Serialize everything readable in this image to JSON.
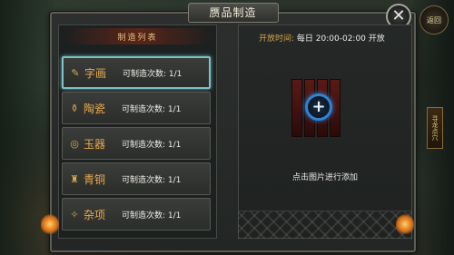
{
  "side": {
    "back_label": "返回",
    "banner_label": "寻龙点穴"
  },
  "panel": {
    "title": "赝品制造",
    "close_glyph": "✕"
  },
  "list": {
    "header": "制造列表",
    "items": [
      {
        "icon": "scroll-icon",
        "glyph": "✎",
        "name": "字画",
        "count": "可制造次数: 1/1",
        "selected": true
      },
      {
        "icon": "pottery-icon",
        "glyph": "⚱",
        "name": "陶瓷",
        "count": "可制造次数: 1/1",
        "selected": false
      },
      {
        "icon": "jade-icon",
        "glyph": "◎",
        "name": "玉器",
        "count": "可制造次数: 1/1",
        "selected": false
      },
      {
        "icon": "bronze-icon",
        "glyph": "♜",
        "name": "青铜",
        "count": "可制造次数: 1/1",
        "selected": false
      },
      {
        "icon": "misc-icon",
        "glyph": "✧",
        "name": "杂项",
        "count": "可制造次数: 1/1",
        "selected": false
      }
    ]
  },
  "detail": {
    "open_label": "开放时间:",
    "open_value": "每日 20:00-02:00 开放",
    "add_hint": "点击图片进行添加",
    "plus_glyph": "+"
  },
  "colors": {
    "accent_gold": "#e8a94c",
    "selected_border": "#7ec0c6",
    "plus_blue": "#2d83d8"
  }
}
